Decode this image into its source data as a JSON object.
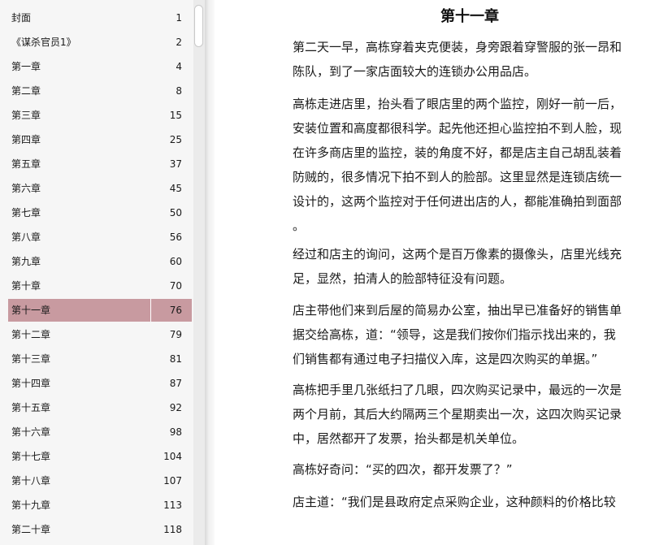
{
  "toc": {
    "items": [
      {
        "title": "封面",
        "page": "1"
      },
      {
        "title": "《谋杀官员1》",
        "page": "2"
      },
      {
        "title": "第一章",
        "page": "4"
      },
      {
        "title": "第二章",
        "page": "8"
      },
      {
        "title": "第三章",
        "page": "15"
      },
      {
        "title": "第四章",
        "page": "25"
      },
      {
        "title": "第五章",
        "page": "37"
      },
      {
        "title": "第六章",
        "page": "45"
      },
      {
        "title": "第七章",
        "page": "50"
      },
      {
        "title": "第八章",
        "page": "56"
      },
      {
        "title": "第九章",
        "page": "60"
      },
      {
        "title": "第十章",
        "page": "70"
      },
      {
        "title": "第十一章",
        "page": "76"
      },
      {
        "title": "第十二章",
        "page": "79"
      },
      {
        "title": "第十三章",
        "page": "81"
      },
      {
        "title": "第十四章",
        "page": "87"
      },
      {
        "title": "第十五章",
        "page": "92"
      },
      {
        "title": "第十六章",
        "page": "98"
      },
      {
        "title": "第十七章",
        "page": "104"
      },
      {
        "title": "第十八章",
        "page": "107"
      },
      {
        "title": "第十九章",
        "page": "113"
      },
      {
        "title": "第二十章",
        "page": "118"
      }
    ],
    "selected_index": 12,
    "selected_color": "#c89aa0"
  },
  "content": {
    "chapter_title": "第十一章",
    "paragraphs": [
      "第二天一早，高栋穿着夹克便装，身旁跟着穿警服的张一昂和\n陈队，到了一家店面较大的连锁办公用品店。",
      "高栋走进店里，抬头看了眼店里的两个监控，刚好一前一后，\n安装位置和高度都很科学。起先他还担心监控拍不到人脸，现\n在许多商店里的监控，装的角度不好，都是店主自己胡乱装着\n防贼的，很多情况下拍不到人的脸部。这里显然是连锁店统一\n设计的，这两个监控对于任何进出店的人，都能准确拍到面部\n。",
      "经过和店主的询问，这两个是百万像素的摄像头，店里光线充\n足，显然，拍清人的脸部特征没有问题。",
      "店主带他们来到后屋的简易办公室，抽出早已准备好的销售单\n据交给高栋，道：“领导，这是我们按你们指示找出来的，我\n们销售都有通过电子扫描仪入库，这是四次购买的单据。”",
      "高栋把手里几张纸扫了几眼，四次购买记录中，最远的一次是\n两个月前，其后大约隔两三个星期卖出一次，这四次购买记录\n中，居然都开了发票，抬头都是机关单位。",
      "高栋好奇问：“买的四次，都开发票了？”",
      "店主道：“我们是县政府定点采购企业，这种颜料的价格比较"
    ]
  }
}
